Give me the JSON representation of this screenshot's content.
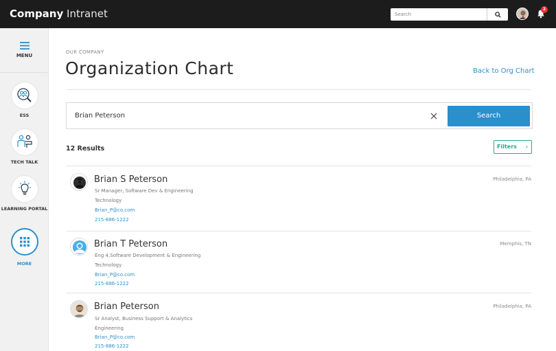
{
  "header": {
    "brand_bold": "Company",
    "brand_light": " Intranet",
    "search_placeholder": "Search",
    "notification_count": "2"
  },
  "sidebar": {
    "menu_label": "MENU",
    "items": [
      {
        "label": "ESS",
        "icon": "people-search-icon"
      },
      {
        "label": "TECH TALK",
        "icon": "presentation-icon"
      },
      {
        "label": "LEARNING PORTAL",
        "icon": "lightbulb-icon"
      },
      {
        "label": "MORE",
        "icon": "grid-icon"
      }
    ]
  },
  "main": {
    "eyebrow": "OUR COMPANY",
    "title": "Organization Chart",
    "back_link": "Back to Org Chart",
    "search_value": "Brian Peterson",
    "search_button": "Search",
    "results_count": "12 Results",
    "filters_label": "Filters",
    "people": [
      {
        "name": "Brian S Peterson",
        "title": "Sr Manager, Software Dev & Engineering",
        "department": "Technology",
        "email": "Brian_P@co.com",
        "phone": "215-886-1222",
        "location": "Philadelphia, PA",
        "avatar": "person-photo-dark"
      },
      {
        "name": "Brian T Peterson",
        "title": "Eng 4,Software Development & Engineering",
        "department": "Technology",
        "email": "Brian_P@co.com",
        "phone": "215-886-1222",
        "location": "Memphis, TN",
        "avatar": "default-avatar-icon"
      },
      {
        "name": "Brian Peterson",
        "title": "Sr Analyst, Business Support & Analytics",
        "department": "Engineering",
        "email": "Brian_P@co.com",
        "phone": "215-886-1222",
        "location": "Philadelphia, PA",
        "avatar": "person-photo"
      }
    ]
  },
  "colors": {
    "accent": "#2a8fcb",
    "filter_green": "#2aa888",
    "topbar": "#1c1c1c",
    "badge": "#e0332b"
  }
}
